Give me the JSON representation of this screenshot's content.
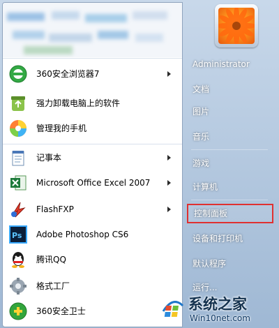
{
  "left_menu": {
    "items": [
      {
        "label": "360安全浏览器7",
        "icon": "360-browser-icon",
        "submenu": true
      },
      {
        "label": "强力卸载电脑上的软件",
        "icon": "uninstall-icon",
        "submenu": false
      },
      {
        "label": "管理我的手机",
        "icon": "phone-manager-icon",
        "submenu": false
      },
      {
        "label": "记事本",
        "icon": "notepad-icon",
        "submenu": true
      },
      {
        "label": "Microsoft Office Excel 2007",
        "icon": "excel-icon",
        "submenu": true
      },
      {
        "label": "FlashFXP",
        "icon": "flashfxp-icon",
        "submenu": true
      },
      {
        "label": "Adobe Photoshop CS6",
        "icon": "photoshop-icon",
        "submenu": false
      },
      {
        "label": "腾讯QQ",
        "icon": "qq-icon",
        "submenu": false
      },
      {
        "label": "格式工厂",
        "icon": "format-factory-icon",
        "submenu": false
      },
      {
        "label": "360安全卫士",
        "icon": "360-safeguard-icon",
        "submenu": false
      }
    ]
  },
  "right_menu": {
    "user_name": "Administrator",
    "items": [
      {
        "label": "文档",
        "highlighted": false
      },
      {
        "label": "图片",
        "highlighted": false
      },
      {
        "label": "音乐",
        "highlighted": false
      },
      {
        "label": "游戏",
        "highlighted": false
      },
      {
        "label": "计算机",
        "highlighted": false
      },
      {
        "label": "控制面板",
        "highlighted": true
      },
      {
        "label": "设备和打印机",
        "highlighted": false
      },
      {
        "label": "默认程序",
        "highlighted": false
      },
      {
        "label": "运行...",
        "highlighted": false
      }
    ]
  },
  "watermark": {
    "title": "系统之家",
    "url": "Win10net.com"
  },
  "colors": {
    "highlight_border": "#e03030",
    "right_pane_bg": "#9fb8d4"
  }
}
